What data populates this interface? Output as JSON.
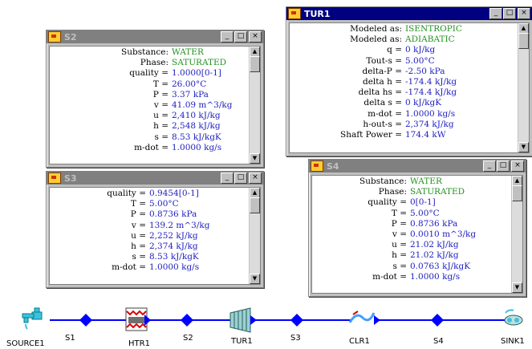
{
  "windows": {
    "s2": {
      "title": "S2",
      "rows": [
        {
          "label": "Substance:",
          "value": "WATER",
          "color": "green"
        },
        {
          "label": "Phase:",
          "value": "SATURATED",
          "color": "green"
        },
        {
          "label": "quality =",
          "value": "1.0000[0-1]"
        },
        {
          "label": "T =",
          "value": "26.00°C"
        },
        {
          "label": "P =",
          "value": "3.37 kPa"
        },
        {
          "label": "v =",
          "value": "41.09 m^3/kg"
        },
        {
          "label": "u =",
          "value": "2,410 kJ/kg"
        },
        {
          "label": "h =",
          "value": "2,548 kJ/kg"
        },
        {
          "label": "s =",
          "value": "8.53 kJ/kgK"
        },
        {
          "label": "m-dot =",
          "value": "1.0000 kg/s"
        }
      ]
    },
    "s3": {
      "title": "S3",
      "rows": [
        {
          "label": "quality =",
          "value": "0.9454[0-1]"
        },
        {
          "label": "T =",
          "value": "5.00°C"
        },
        {
          "label": "P =",
          "value": "0.8736 kPa"
        },
        {
          "label": "v =",
          "value": "139.2 m^3/kg"
        },
        {
          "label": "u =",
          "value": "2,252 kJ/kg"
        },
        {
          "label": "h =",
          "value": "2,374 kJ/kg"
        },
        {
          "label": "s =",
          "value": "8.53 kJ/kgK"
        },
        {
          "label": "m-dot =",
          "value": "1.0000 kg/s"
        }
      ]
    },
    "tur1": {
      "title": "TUR1",
      "rows": [
        {
          "label": "Modeled as:",
          "value": "ISENTROPIC",
          "color": "green"
        },
        {
          "label": "Modeled as:",
          "value": "ADIABATIC",
          "color": "green"
        },
        {
          "label": "q =",
          "value": "0 kJ/kg"
        },
        {
          "label": "Tout-s =",
          "value": "5.00°C"
        },
        {
          "label": "delta-P =",
          "value": "-2.50 kPa"
        },
        {
          "label": "delta h =",
          "value": "-174.4 kJ/kg"
        },
        {
          "label": "delta hs =",
          "value": "-174.4 kJ/kg"
        },
        {
          "label": "delta s =",
          "value": "0 kJ/kgK"
        },
        {
          "label": "m-dot =",
          "value": "1.0000 kg/s"
        },
        {
          "label": "h-out-s =",
          "value": "2,374 kJ/kg"
        },
        {
          "label": "Shaft Power =",
          "value": "174.4 kW"
        }
      ]
    },
    "s4": {
      "title": "S4",
      "rows": [
        {
          "label": "Substance:",
          "value": "WATER",
          "color": "green"
        },
        {
          "label": "Phase:",
          "value": "SATURATED",
          "color": "green"
        },
        {
          "label": "quality =",
          "value": "0[0-1]"
        },
        {
          "label": "T =",
          "value": "5.00°C"
        },
        {
          "label": "P =",
          "value": "0.8736 kPa"
        },
        {
          "label": "v =",
          "value": "0.0010 m^3/kg"
        },
        {
          "label": "u =",
          "value": "21.02 kJ/kg"
        },
        {
          "label": "h =",
          "value": "21.02 kJ/kg"
        },
        {
          "label": "s =",
          "value": "0.0763 kJ/kgK"
        },
        {
          "label": "m-dot =",
          "value": "1.0000 kg/s"
        }
      ]
    }
  },
  "window_buttons": {
    "minimize": "_",
    "maximize": "□",
    "close": "×"
  },
  "flowsheet": {
    "nodes": [
      "SOURCE1",
      "S1",
      "HTR1",
      "S2",
      "TUR1",
      "S3",
      "CLR1",
      "S4",
      "SINK1"
    ],
    "stream_color": "#0000ff"
  }
}
